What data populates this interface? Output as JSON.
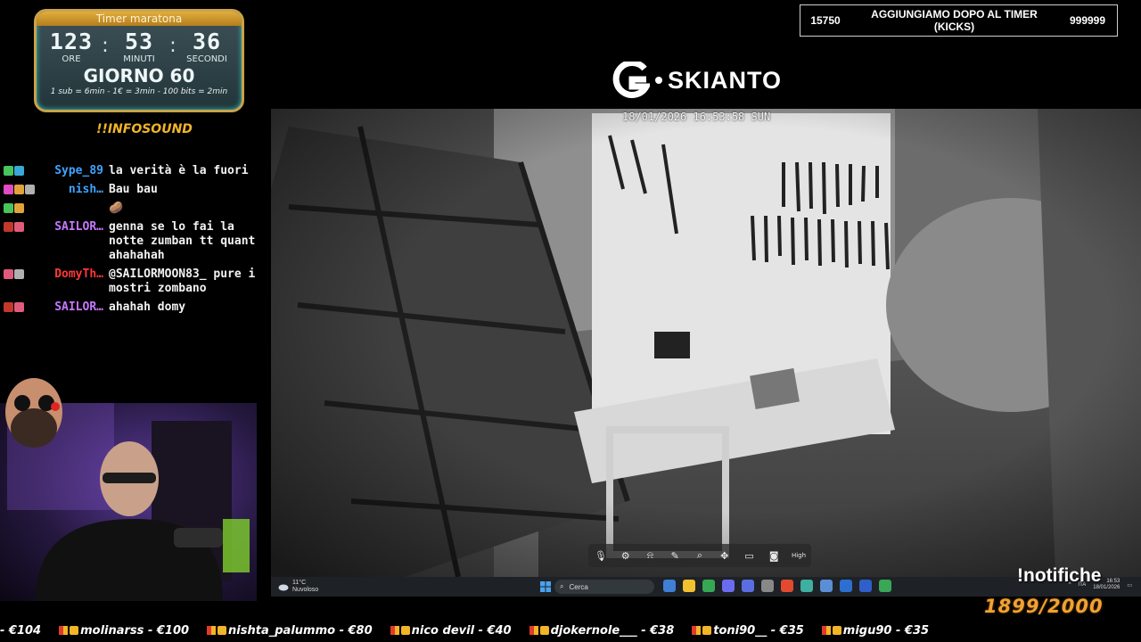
{
  "timer": {
    "title": "Timer maratona",
    "hours": "123",
    "minutes": "53",
    "seconds": "36",
    "hours_label": "ORE",
    "minutes_label": "MINUTI",
    "seconds_label": "SECONDI",
    "day": "GIORNO 60",
    "rate": "1 sub = 6min - 1€ = 3min - 100 bits = 2min"
  },
  "infosound": "!!INFOSOUND",
  "chat": [
    {
      "user": "Sype_89",
      "color": "#3fa4ff",
      "text": "la verità è la fuori",
      "badges": [
        "#49c35b",
        "#3aa7d6"
      ]
    },
    {
      "user": "nish…",
      "color": "#3fa4ff",
      "text": "Bau bau",
      "badges": [
        "#e04bc3",
        "#e0a33a",
        "#b0b0b0"
      ]
    },
    {
      "user": "",
      "color": "#3fa4ff",
      "text": "🥔",
      "badges": [
        "#49c35b",
        "#e0a33a"
      ]
    },
    {
      "user": "SAILOR…",
      "color": "#c678ff",
      "text": "genna se lo fai la notte zumban tt quant ahahahah",
      "badges": [
        "#c0392b",
        "#e05b7a"
      ]
    },
    {
      "user": "DomyTh…",
      "color": "#ff3838",
      "text": "@SAILORMOON83_ pure i mostri zombano",
      "badges": [
        "#e05b7a",
        "#b0b0b0"
      ]
    },
    {
      "user": "SAILOR…",
      "color": "#c678ff",
      "text": "ahahah domy",
      "badges": [
        "#c0392b",
        "#e05b7a"
      ]
    }
  ],
  "notification": {
    "left": "15750",
    "message": "AGGIUNGIAMO DOPO AL TIMER (KICKS)",
    "right": "999999"
  },
  "logo": {
    "name": "SKIANTO"
  },
  "camera": {
    "timestamp": "18/01/2026  16:53:58 SUN"
  },
  "camera_toolbar": [
    "mic-icon",
    "palette-icon",
    "alarm-icon",
    "pen-icon",
    "zoom-icon",
    "ptz-icon",
    "record-icon",
    "snapshot-icon",
    "quality-icon"
  ],
  "camera_toolbar_quality": "High",
  "taskbar": {
    "temp": "11°C",
    "weather": "Nuvoloso",
    "search": "Cerca",
    "lang": "ITA",
    "time": "16:53",
    "date": "18/01/2026",
    "apps": [
      "#3f7fd6",
      "#f2c12e",
      "#36a854",
      "#6a6cf0",
      "#5b6ee1",
      "#888888",
      "#e24a2f",
      "#3fb0a0",
      "#5a8fd6",
      "#2d6fd1",
      "#2f5fc9",
      "#3aa657"
    ]
  },
  "notifiche_cmd": "!notifiche",
  "goal": {
    "current": "1899",
    "target": "2000"
  },
  "ticker": [
    "- €104",
    "molinarss - €100",
    "nishta_palummo - €80",
    "nico devil - €40",
    "djokernole___ - €38",
    "toni90__ - €35",
    "migu90 - €35"
  ]
}
